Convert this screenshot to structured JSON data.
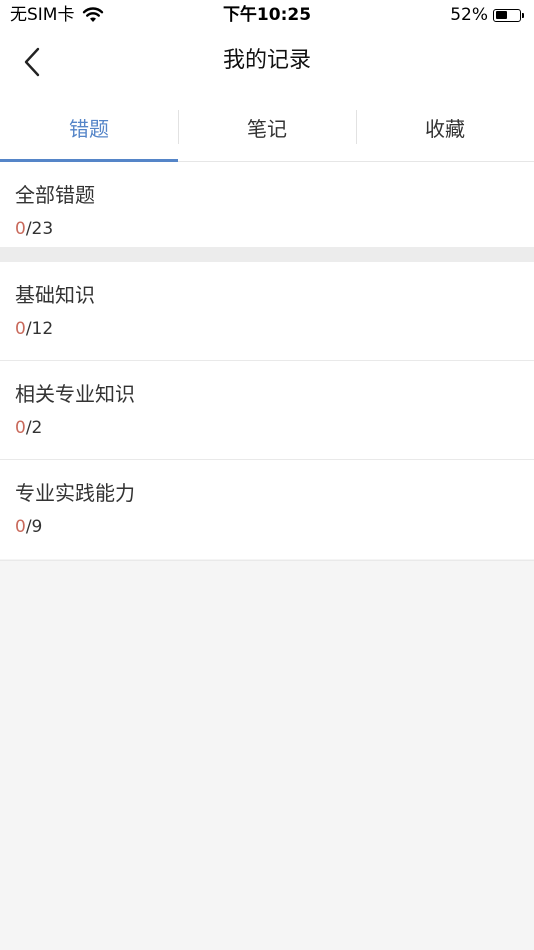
{
  "status_bar": {
    "carrier": "无SIM卡",
    "time": "下午10:25",
    "battery": "52%",
    "battery_level": 0.52
  },
  "nav": {
    "back_icon": "chevron-left-icon",
    "title": "我的记录"
  },
  "tabs": [
    {
      "label": "错题",
      "active": true
    },
    {
      "label": "笔记",
      "active": false
    },
    {
      "label": "收藏",
      "active": false
    }
  ],
  "summary": {
    "title": "全部错题",
    "done": "0",
    "total": "/23"
  },
  "categories": [
    {
      "title": "基础知识",
      "done": "0",
      "total": "/12"
    },
    {
      "title": "相关专业知识",
      "done": "0",
      "total": "/2"
    },
    {
      "title": "专业实践能力",
      "done": "0",
      "total": "/9"
    }
  ],
  "colors": {
    "accent": "#5585c8",
    "done_count": "#c96a5c",
    "background": "#f5f5f5"
  }
}
